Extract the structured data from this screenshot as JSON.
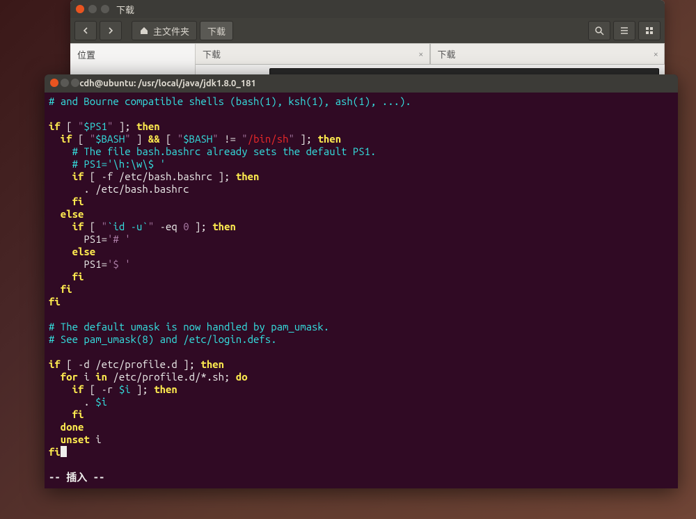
{
  "nautilus": {
    "title": "下载",
    "back_tip": "后退",
    "fwd_tip": "前进",
    "home_label": "主文件夹",
    "current_dir": "下载",
    "sidebar_header": "位置",
    "tabs": [
      {
        "label": "下载"
      },
      {
        "label": "下载"
      }
    ],
    "search_tip": "搜索",
    "menu_tip": "菜单",
    "grid_tip": "视图"
  },
  "terminal": {
    "title": "cdh@ubuntu: /usr/local/java/jdk1.8.0_181",
    "mode": "-- 插入 --",
    "code": {
      "l1": "# and Bourne compatible shells (bash(1), ksh(1), ash(1), ...).",
      "l2a": "if",
      "l2b": " [ ",
      "l2c": "\"",
      "l2d": "$PS1",
      "l2e": "\"",
      "l2f": " ]; ",
      "l2g": "then",
      "l3a": "  if",
      "l3b": " [ ",
      "l3c": "\"",
      "l3d": "$BASH",
      "l3e": "\"",
      "l3f": " ] ",
      "l3g": "&&",
      "l3h": " [ ",
      "l3i": "\"",
      "l3j": "$BASH",
      "l3k": "\"",
      "l3l": " != ",
      "l3m": "\"",
      "l3n": "/bin/sh",
      "l3o": "\"",
      "l3p": " ]; ",
      "l3q": "then",
      "l4": "    # The file bash.bashrc already sets the default PS1.",
      "l5": "    # PS1='\\h:\\w\\$ '",
      "l6a": "    if",
      "l6b": " [ -f /etc/bash.bashrc ]; ",
      "l6c": "then",
      "l7": "      . /etc/bash.bashrc",
      "l8": "    fi",
      "l9": "  else",
      "l10a": "    if",
      "l10b": " [ ",
      "l10c": "\"",
      "l10d": "`id -u`",
      "l10e": "\"",
      "l10f": " -eq ",
      "l10g": "0",
      "l10h": " ]; ",
      "l10i": "then",
      "l11a": "      PS1=",
      "l11b": "'# '",
      "l12": "    else",
      "l13a": "      PS1=",
      "l13b": "'$ '",
      "l14": "    fi",
      "l15": "  fi",
      "l16": "fi",
      "l17": "# The default umask is now handled by pam_umask.",
      "l18": "# See pam_umask(8) and /etc/login.defs.",
      "l19a": "if",
      "l19b": " [ -d /etc/profile.d ]; ",
      "l19c": "then",
      "l20a": "  for",
      "l20b": " i ",
      "l20c": "in",
      "l20d": " /etc/profile.d/*.sh; ",
      "l20e": "do",
      "l21a": "    if",
      "l21b": " [ -r ",
      "l21c": "$i",
      "l21d": " ]; ",
      "l21e": "then",
      "l22a": "      . ",
      "l22b": "$i",
      "l23": "    fi",
      "l24": "  done",
      "l25a": "  unset",
      "l25b": " i",
      "l26": "fi"
    }
  }
}
